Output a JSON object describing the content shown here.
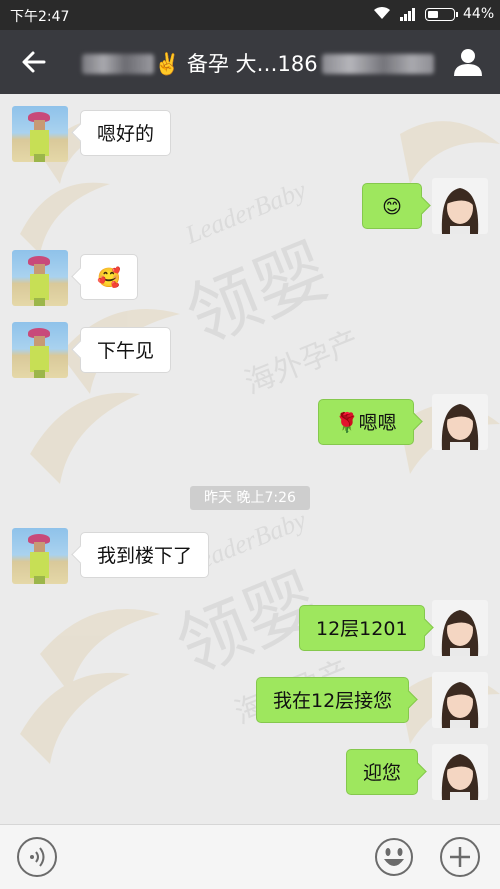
{
  "status_bar": {
    "time": "下午2:47",
    "battery_percent": "44%",
    "battery_level": 0.44
  },
  "header": {
    "title_prefix": "备孕 大…186",
    "back_icon": "arrow-left-icon",
    "profile_icon": "person-icon"
  },
  "watermark": {
    "brand_en": "LeaderBaby",
    "brand_cn": "领婴",
    "tagline": "海外孕产"
  },
  "messages": [
    {
      "side": "in",
      "text": "嗯好的"
    },
    {
      "side": "out",
      "text": "😊"
    },
    {
      "side": "in",
      "text": "🥰"
    },
    {
      "side": "in",
      "text": "下午见"
    },
    {
      "side": "out",
      "text": "🌹嗯嗯"
    },
    {
      "side": "in",
      "text": "我到楼下了"
    },
    {
      "side": "out",
      "text": "12层1201"
    },
    {
      "side": "out",
      "text": "我在12层接您"
    },
    {
      "side": "out",
      "text": "迎您"
    }
  ],
  "timestamp": "昨天 晚上7:26",
  "input_bar": {
    "voice_icon": "voice-icon",
    "emoji_icon": "emoji-icon",
    "plus_icon": "plus-icon"
  },
  "colors": {
    "header_bg": "#393a3f",
    "bubble_out": "#9ee75e",
    "bubble_in": "#ffffff",
    "chat_bg": "#ebebeb"
  }
}
